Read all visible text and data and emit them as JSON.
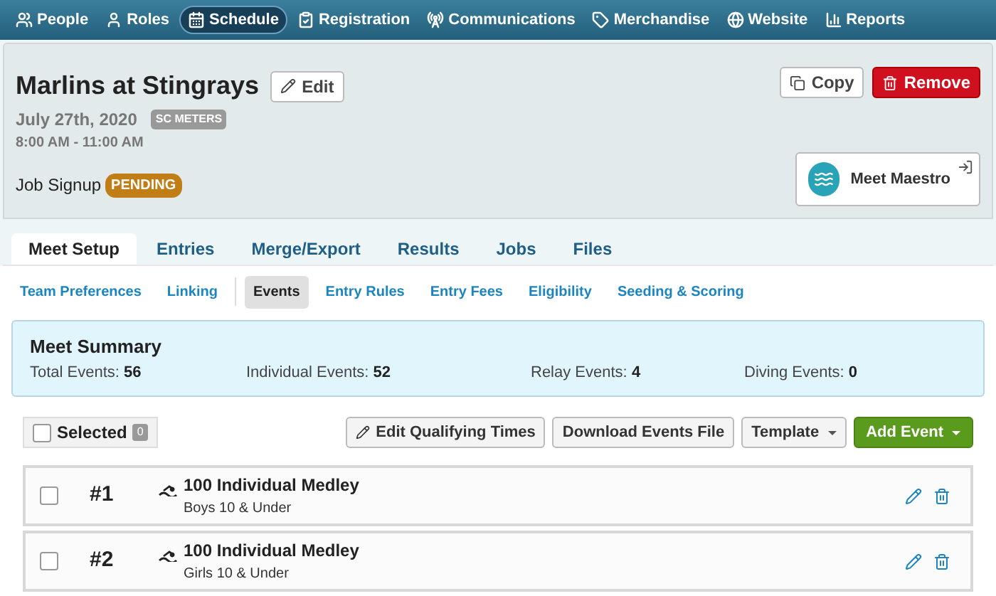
{
  "nav": [
    {
      "label": "People",
      "selected": false
    },
    {
      "label": "Roles",
      "selected": false
    },
    {
      "label": "Schedule",
      "selected": true
    },
    {
      "label": "Registration",
      "selected": false
    },
    {
      "label": "Communications",
      "selected": false
    },
    {
      "label": "Merchandise",
      "selected": false
    },
    {
      "label": "Website",
      "selected": false
    },
    {
      "label": "Reports",
      "selected": false
    }
  ],
  "meet": {
    "title": "Marlins at Stingrays",
    "edit": "Edit",
    "date": "July 27th, 2020",
    "course": "SC METERS",
    "time": "8:00 AM - 11:00 AM",
    "job_signup": "Job Signup",
    "job_status": "PENDING",
    "copy": "Copy",
    "remove": "Remove",
    "maestro": "Meet Maestro"
  },
  "tabs": [
    {
      "label": "Meet Setup",
      "selected": true
    },
    {
      "label": "Entries",
      "selected": false
    },
    {
      "label": "Merge/Export",
      "selected": false
    },
    {
      "label": "Results",
      "selected": false
    },
    {
      "label": "Jobs",
      "selected": false
    },
    {
      "label": "Files",
      "selected": false
    }
  ],
  "subtabs": [
    {
      "label": "Team Preferences",
      "selected": false
    },
    {
      "label": "Linking",
      "selected": false
    },
    {
      "label": "Events",
      "selected": true
    },
    {
      "label": "Entry Rules",
      "selected": false
    },
    {
      "label": "Entry Fees",
      "selected": false
    },
    {
      "label": "Eligibility",
      "selected": false
    },
    {
      "label": "Seeding & Scoring",
      "selected": false
    }
  ],
  "summary": {
    "title": "Meet Summary",
    "stats": [
      {
        "label": "Total Events:",
        "value": "56"
      },
      {
        "label": "Individual Events:",
        "value": "52"
      },
      {
        "label": "Relay Events:",
        "value": "4"
      },
      {
        "label": "Diving Events:",
        "value": "0"
      }
    ]
  },
  "toolbar": {
    "selected_label": "Selected",
    "selected_checked": false,
    "selected_count": "0",
    "edit_times": "Edit Qualifying Times",
    "download": "Download Events File",
    "template": "Template",
    "add": "Add Event"
  },
  "events": [
    {
      "number": "#1",
      "name": "100 Individual Medley",
      "group": "Boys 10 & Under",
      "checked": false
    },
    {
      "number": "#2",
      "name": "100 Individual Medley",
      "group": "Girls 10 & Under",
      "checked": false
    }
  ]
}
